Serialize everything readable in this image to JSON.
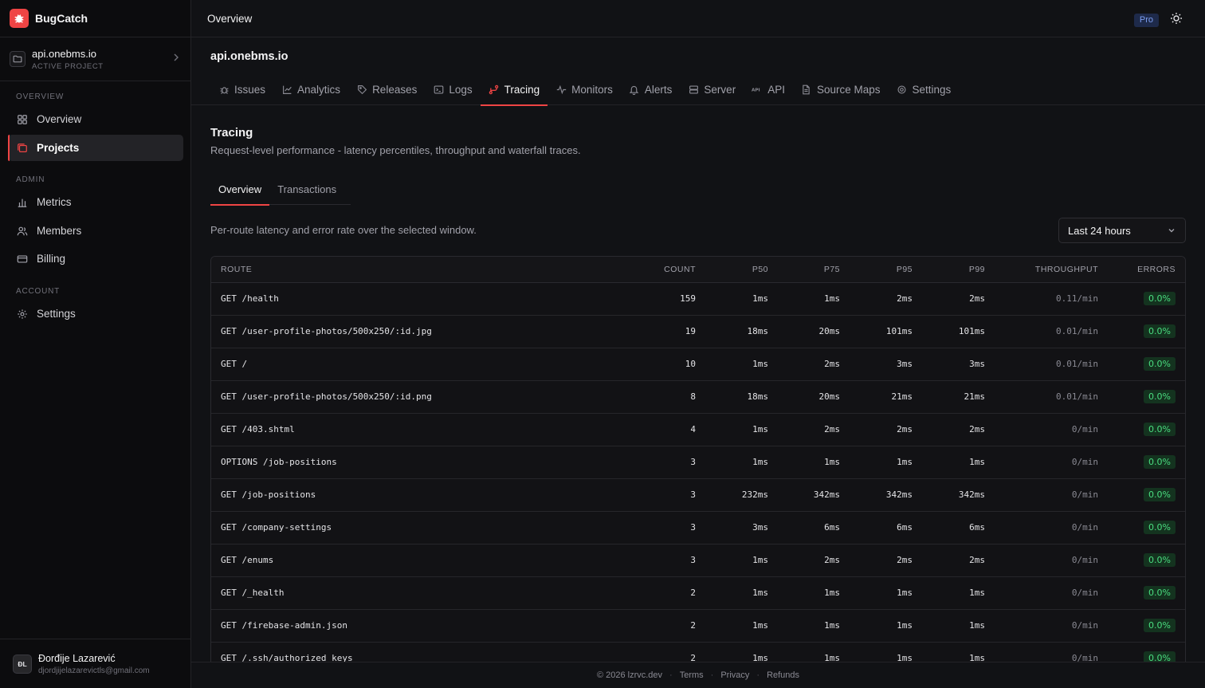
{
  "brand": {
    "name": "BugCatch"
  },
  "project_switch": {
    "name": "api.onebms.io",
    "subtitle": "ACTIVE PROJECT"
  },
  "sidebar": {
    "sections": [
      {
        "label": "OVERVIEW"
      },
      {
        "label": "ADMIN"
      },
      {
        "label": "ACCOUNT"
      }
    ],
    "items": [
      {
        "label": "Overview",
        "icon": "grid-icon"
      },
      {
        "label": "Projects",
        "icon": "folders-icon",
        "active": true
      },
      {
        "label": "Metrics",
        "icon": "bar-chart-icon"
      },
      {
        "label": "Members",
        "icon": "users-icon"
      },
      {
        "label": "Billing",
        "icon": "credit-card-icon"
      },
      {
        "label": "Settings",
        "icon": "gear-icon"
      }
    ]
  },
  "user": {
    "initials": "ĐL",
    "name": "Đorđije Lazarević",
    "email": "djordjijelazarevictls@gmail.com"
  },
  "topbar": {
    "title": "Overview",
    "plan_badge": "Pro"
  },
  "project": {
    "title": "api.onebms.io",
    "tabs": [
      {
        "label": "Issues",
        "icon": "bug-icon"
      },
      {
        "label": "Analytics",
        "icon": "line-chart-icon"
      },
      {
        "label": "Releases",
        "icon": "tag-icon"
      },
      {
        "label": "Logs",
        "icon": "terminal-icon"
      },
      {
        "label": "Tracing",
        "icon": "route-icon",
        "active": true
      },
      {
        "label": "Monitors",
        "icon": "pulse-icon"
      },
      {
        "label": "Alerts",
        "icon": "bell-icon"
      },
      {
        "label": "Server",
        "icon": "server-icon"
      },
      {
        "label": "API",
        "icon": "api-icon"
      },
      {
        "label": "Source Maps",
        "icon": "file-icon"
      },
      {
        "label": "Settings",
        "icon": "gear-icon"
      }
    ]
  },
  "tracing": {
    "title": "Tracing",
    "description": "Request-level performance - latency percentiles, throughput and waterfall traces.",
    "subtabs": [
      {
        "label": "Overview",
        "active": true
      },
      {
        "label": "Transactions"
      }
    ],
    "filter_description": "Per-route latency and error rate over the selected window.",
    "range": {
      "selected": "Last 24 hours"
    },
    "table": {
      "headers": [
        "ROUTE",
        "COUNT",
        "P50",
        "P75",
        "P95",
        "P99",
        "THROUGHPUT",
        "ERRORS"
      ],
      "rows": [
        [
          "GET /health",
          "159",
          "1ms",
          "1ms",
          "2ms",
          "2ms",
          "0.11/min",
          "0.0%"
        ],
        [
          "GET /user-profile-photos/500x250/:id.jpg",
          "19",
          "18ms",
          "20ms",
          "101ms",
          "101ms",
          "0.01/min",
          "0.0%"
        ],
        [
          "GET /",
          "10",
          "1ms",
          "2ms",
          "3ms",
          "3ms",
          "0.01/min",
          "0.0%"
        ],
        [
          "GET /user-profile-photos/500x250/:id.png",
          "8",
          "18ms",
          "20ms",
          "21ms",
          "21ms",
          "0.01/min",
          "0.0%"
        ],
        [
          "GET /403.shtml",
          "4",
          "1ms",
          "2ms",
          "2ms",
          "2ms",
          "0/min",
          "0.0%"
        ],
        [
          "OPTIONS /job-positions",
          "3",
          "1ms",
          "1ms",
          "1ms",
          "1ms",
          "0/min",
          "0.0%"
        ],
        [
          "GET /job-positions",
          "3",
          "232ms",
          "342ms",
          "342ms",
          "342ms",
          "0/min",
          "0.0%"
        ],
        [
          "GET /company-settings",
          "3",
          "3ms",
          "6ms",
          "6ms",
          "6ms",
          "0/min",
          "0.0%"
        ],
        [
          "GET /enums",
          "3",
          "1ms",
          "2ms",
          "2ms",
          "2ms",
          "0/min",
          "0.0%"
        ],
        [
          "GET /_health",
          "2",
          "1ms",
          "1ms",
          "1ms",
          "1ms",
          "0/min",
          "0.0%"
        ],
        [
          "GET /firebase-admin.json",
          "2",
          "1ms",
          "1ms",
          "1ms",
          "1ms",
          "0/min",
          "0.0%"
        ],
        [
          "GET /.ssh/authorized_keys",
          "2",
          "1ms",
          "1ms",
          "1ms",
          "1ms",
          "0/min",
          "0.0%"
        ]
      ]
    }
  },
  "footer": {
    "copyright": "© 2026 lzrvc.dev",
    "links": [
      "Terms",
      "Privacy",
      "Refunds"
    ]
  },
  "colors": {
    "accent": "#ef4444",
    "success": "#4ade80",
    "background": "#111215",
    "sidebar": "#0c0c0e"
  }
}
